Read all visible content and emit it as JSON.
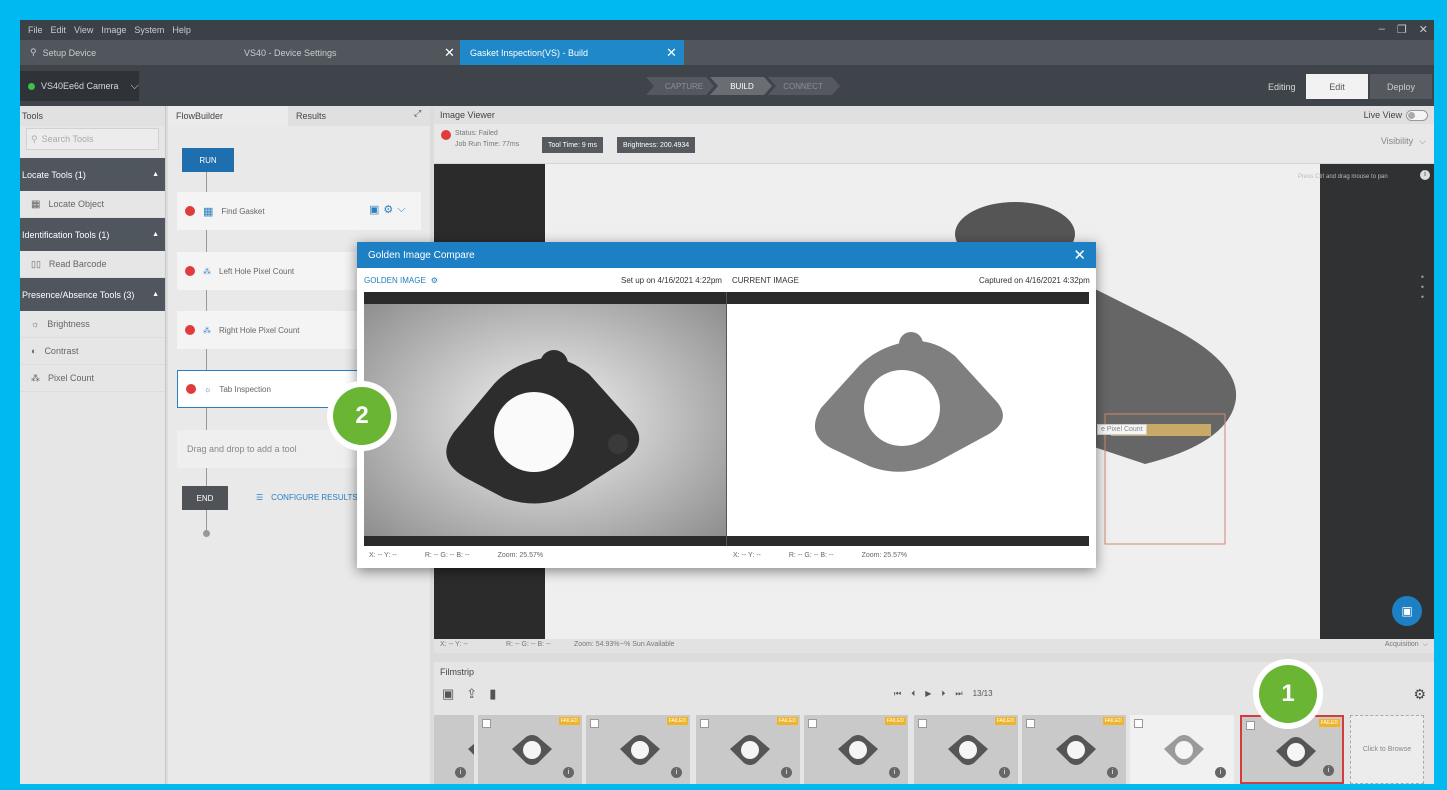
{
  "menu": {
    "items": [
      "File",
      "Edit",
      "View",
      "Image",
      "System",
      "Help"
    ]
  },
  "tabs": [
    {
      "label": "Setup Device"
    },
    {
      "label": "VS40 - Device Settings"
    },
    {
      "label": "Gasket Inspection(VS) - Build"
    }
  ],
  "device": {
    "name": "VS40Ee6d Camera"
  },
  "workflow": {
    "steps": [
      "CAPTURE",
      "BUILD",
      "CONNECT"
    ],
    "current": "BUILD"
  },
  "mode": {
    "label": "Editing",
    "edit": "Edit",
    "deploy": "Deploy"
  },
  "tools": {
    "title": "Tools",
    "search_placeholder": "Search Tools",
    "categories": [
      {
        "label": "Locate Tools (1)",
        "items": [
          "Locate Object"
        ]
      },
      {
        "label": "Identification Tools (1)",
        "items": [
          "Read Barcode"
        ]
      },
      {
        "label": "Presence/Absence Tools (3)",
        "items": [
          "Brightness",
          "Contrast",
          "Pixel Count"
        ]
      }
    ]
  },
  "flow": {
    "tabs": [
      "FlowBuilder",
      "Results"
    ],
    "run": "RUN",
    "nodes": [
      "Find Gasket",
      "Left Hole Pixel Count",
      "Right Hole Pixel Count",
      "Tab Inspection"
    ],
    "drag_hint": "Drag and drop to add a tool",
    "end": "END",
    "configure": "CONFIGURE RESULTS"
  },
  "viewer": {
    "title": "Image Viewer",
    "live_view": "Live View",
    "status": "Status:  Failed",
    "job_run_time": "Job Run Time:  77ms",
    "tool_time": "Tool Time: 9 ms",
    "brightness": "Brightness: 200.4934",
    "visibility": "Visibility",
    "hint": "Press Ctrl and drag mouse to pan",
    "overlay_label": "e Pixel Count",
    "footer": {
      "xy": "X: -- Y: --",
      "rgb": "R: -- G: -- B: --",
      "zoom": "Zoom: 54.93%",
      "sun": "~% Sun Available",
      "acq": "Acquisition"
    }
  },
  "filmstrip": {
    "title": "Filmstrip",
    "counter": "13/13",
    "browse": "Click to Browse",
    "badge": "FAILED"
  },
  "modal": {
    "title": "Golden Image Compare",
    "golden_label": "GOLDEN IMAGE",
    "setup": "Set up on 4/16/2021 4:22pm",
    "current_label": "CURRENT IMAGE",
    "captured": "Captured on 4/16/2021 4:32pm",
    "left_footer": {
      "xy": "X: -- Y: --",
      "rgb": "R: -- G: -- B: --",
      "zoom": "Zoom: 25.57%"
    },
    "right_footer": {
      "xy": "X: -- Y: --",
      "rgb": "R: -- G: -- B: --",
      "zoom": "Zoom: 25.57%"
    }
  },
  "callouts": [
    "2",
    "1"
  ],
  "colors": {
    "accent": "#1d7fc4",
    "frame": "#00b9f0",
    "fail": "#e03c3c",
    "callout": "#6bb535",
    "badge": "#f0b428"
  }
}
